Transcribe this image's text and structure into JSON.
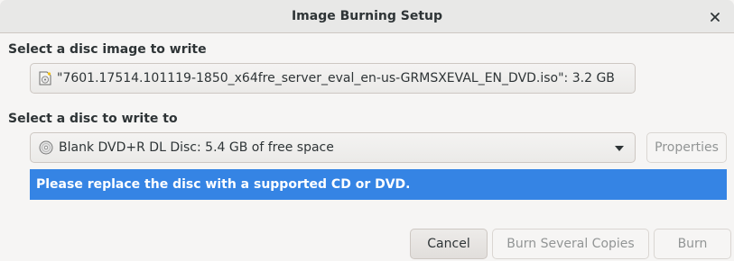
{
  "window": {
    "title": "Image Burning Setup",
    "close_icon": "close-icon"
  },
  "image_section": {
    "label": "Select a disc image to write",
    "file_icon": "disc-image-file-icon",
    "file_text": "\"7601.17514.101119-1850_x64fre_server_eval_en-us-GRMSXEVAL_EN_DVD.iso\": 3.2 GB"
  },
  "disc_section": {
    "label": "Select a disc to write to",
    "disc_icon": "optical-disc-icon",
    "selected_disc": "Blank DVD+R DL Disc: 5.4 GB of free space",
    "properties_label": "Properties"
  },
  "info_bar": {
    "message": "Please replace the disc with a supported CD or DVD.",
    "color": "#3584e4"
  },
  "footer": {
    "cancel_label": "Cancel",
    "burn_several_label": "Burn Several Copies",
    "burn_label": "Burn"
  }
}
